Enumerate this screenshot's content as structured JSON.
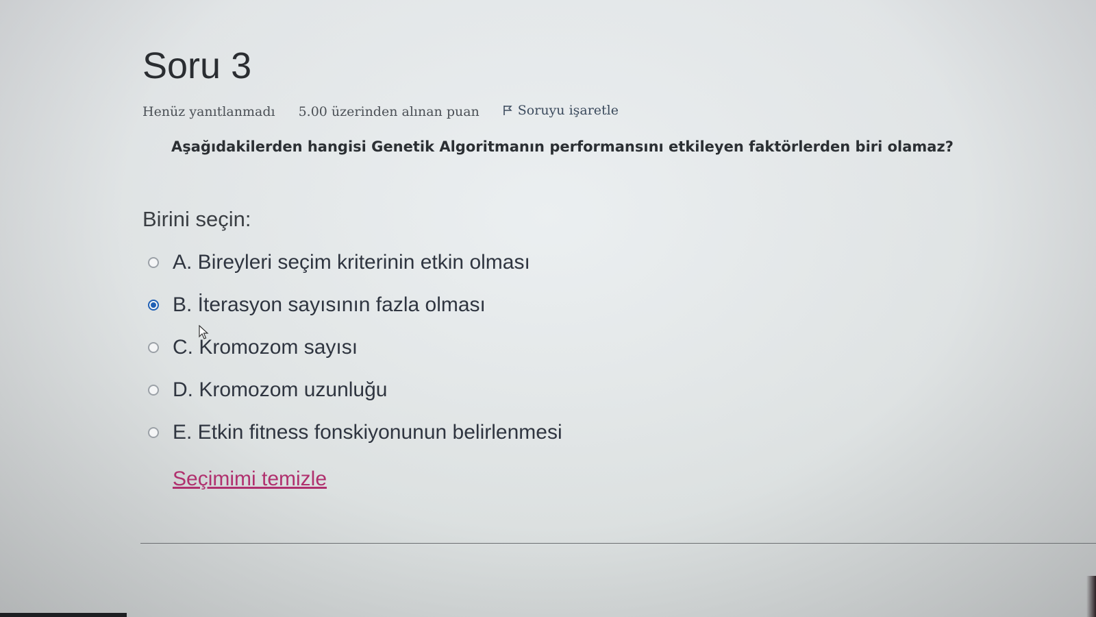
{
  "question": {
    "title": "Soru 3",
    "status": "Henüz yanıtlanmadı",
    "grade": "5.00 üzerinden alınan puan",
    "flag_label": "Soruyu işaretle",
    "text": "Aşağıdakilerden hangisi Genetik Algoritmanın performansını etkileyen faktörlerden biri olamaz?",
    "prompt": "Birini seçin:",
    "answers": [
      {
        "label": "A. Bireyleri seçim kriterinin etkin olması",
        "selected": false
      },
      {
        "label": "B. İterasyon sayısının fazla olması",
        "selected": true
      },
      {
        "label": "C. Kromozom sayısı",
        "selected": false
      },
      {
        "label": "D. Kromozom uzunluğu",
        "selected": false
      },
      {
        "label": "E. Etkin fitness fonskiyonunun belirlenmesi",
        "selected": false
      }
    ],
    "clear_label": "Seçimimi temizle"
  },
  "colors": {
    "accent_radio": "#1f5fb5",
    "link": "#b0306e"
  }
}
